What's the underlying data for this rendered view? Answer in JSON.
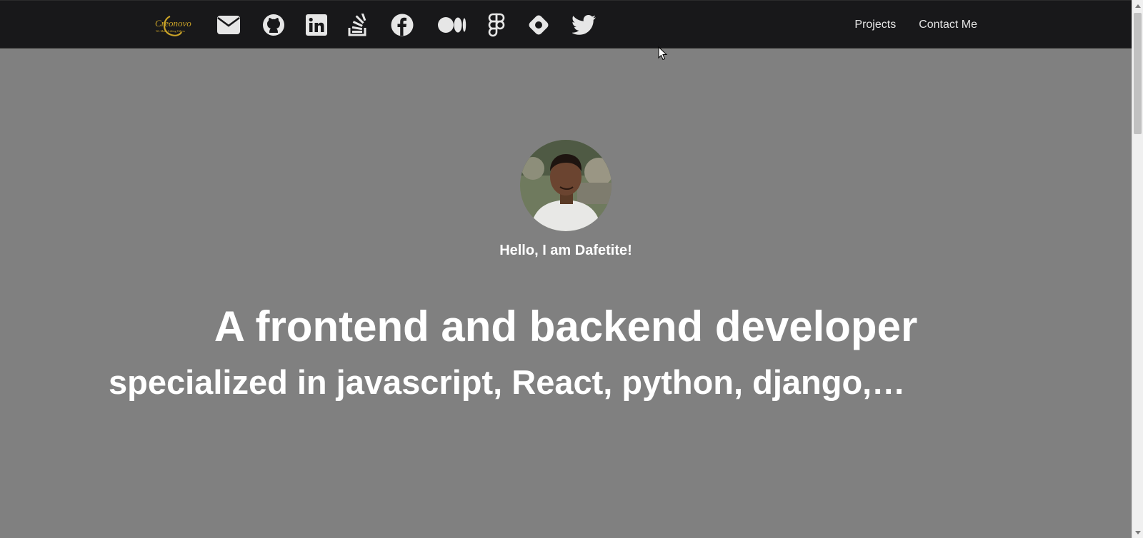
{
  "navbar": {
    "logo": {
      "text": "Creonovo",
      "tagline": "We Make Lifting Others"
    },
    "social_links": [
      {
        "name": "email-icon"
      },
      {
        "name": "github-icon"
      },
      {
        "name": "linkedin-icon"
      },
      {
        "name": "stackoverflow-icon"
      },
      {
        "name": "facebook-icon"
      },
      {
        "name": "medium-icon"
      },
      {
        "name": "figma-icon"
      },
      {
        "name": "codementor-icon"
      },
      {
        "name": "twitter-icon"
      }
    ],
    "links": {
      "projects": "Projects",
      "contact": "Contact Me"
    }
  },
  "hero": {
    "greeting": "Hello, I am Dafetite!",
    "headline": "A frontend and backend developer",
    "subline": "specialized in javascript, React, python, django,…"
  },
  "colors": {
    "navbar_bg": "#18181a",
    "page_bg": "#808080",
    "logo_gold": "#c9a227",
    "text": "#ffffff"
  }
}
